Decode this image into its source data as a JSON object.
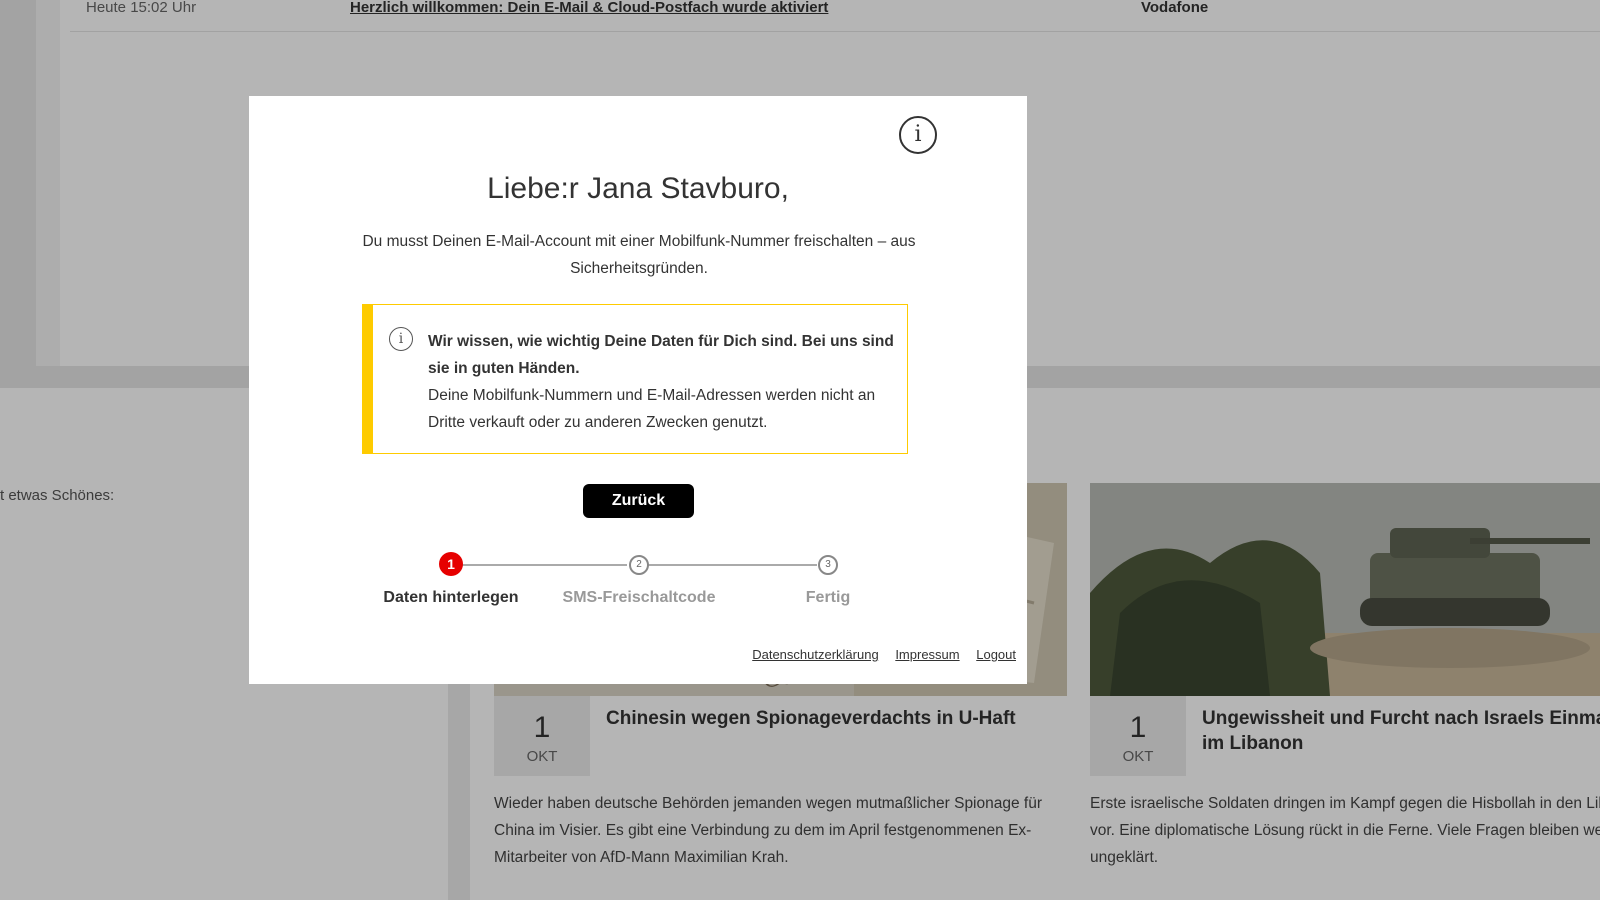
{
  "mail_row": {
    "date": "Heute 15:02 Uhr",
    "subject": "Herzlich willkommen: Dein E-Mail & Cloud-Postfach wurde aktiviert",
    "sender": "Vodafone"
  },
  "promo_text": "t etwas Schönes:",
  "news": [
    {
      "day": "1",
      "month": "OKT",
      "title": "Chinesin wegen Spionageverdachts in U-Haft",
      "description": "Wieder haben deutsche Behörden jemanden wegen mutmaßlicher Spionage für China im Visier. Es gibt eine Verbindung zu dem im April festgenommenen Ex-Mitarbeiter von AfD-Mann Maximilian Krah."
    },
    {
      "day": "1",
      "month": "OKT",
      "title": "Ungewissheit und Furcht nach Israels Einmar",
      "title_line2": "im Libanon",
      "description": "Erste israelische Soldaten dringen im Kampf gegen die Hisbollah in den Lib vor. Eine diplomatische Lösung rückt in die Ferne. Viele Fragen bleiben wei ungeklärt."
    }
  ],
  "modal": {
    "info_icon": "info-circle-icon",
    "title": "Liebe:r Jana Stavburo,",
    "description": "Du musst Deinen E-Mail-Account mit einer Mobilfunk-Nummer freischalten – aus Sicherheitsgründen.",
    "notice": {
      "icon": "info-circle-icon",
      "strong": "Wir wissen, wie wichtig Deine Daten für Dich sind. Bei uns sind sie in guten Händen.",
      "text": "Deine Mobilfunk-Nummern und E-Mail-Adressen werden nicht an Dritte verkauft oder zu anderen Zwecken genutzt."
    },
    "back_button": "Zurück",
    "steps": [
      {
        "number": "1",
        "label": "Daten hinterlegen",
        "active": true
      },
      {
        "number": "2",
        "label": "SMS-Freischaltcode",
        "active": false
      },
      {
        "number": "3",
        "label": "Fertig",
        "active": false
      }
    ],
    "footer_links": [
      "Datenschutzerklärung",
      "Impressum",
      "Logout"
    ]
  },
  "colors": {
    "accent_red": "#e60000",
    "notice_yellow": "#fecb00",
    "button_black": "#000000"
  }
}
